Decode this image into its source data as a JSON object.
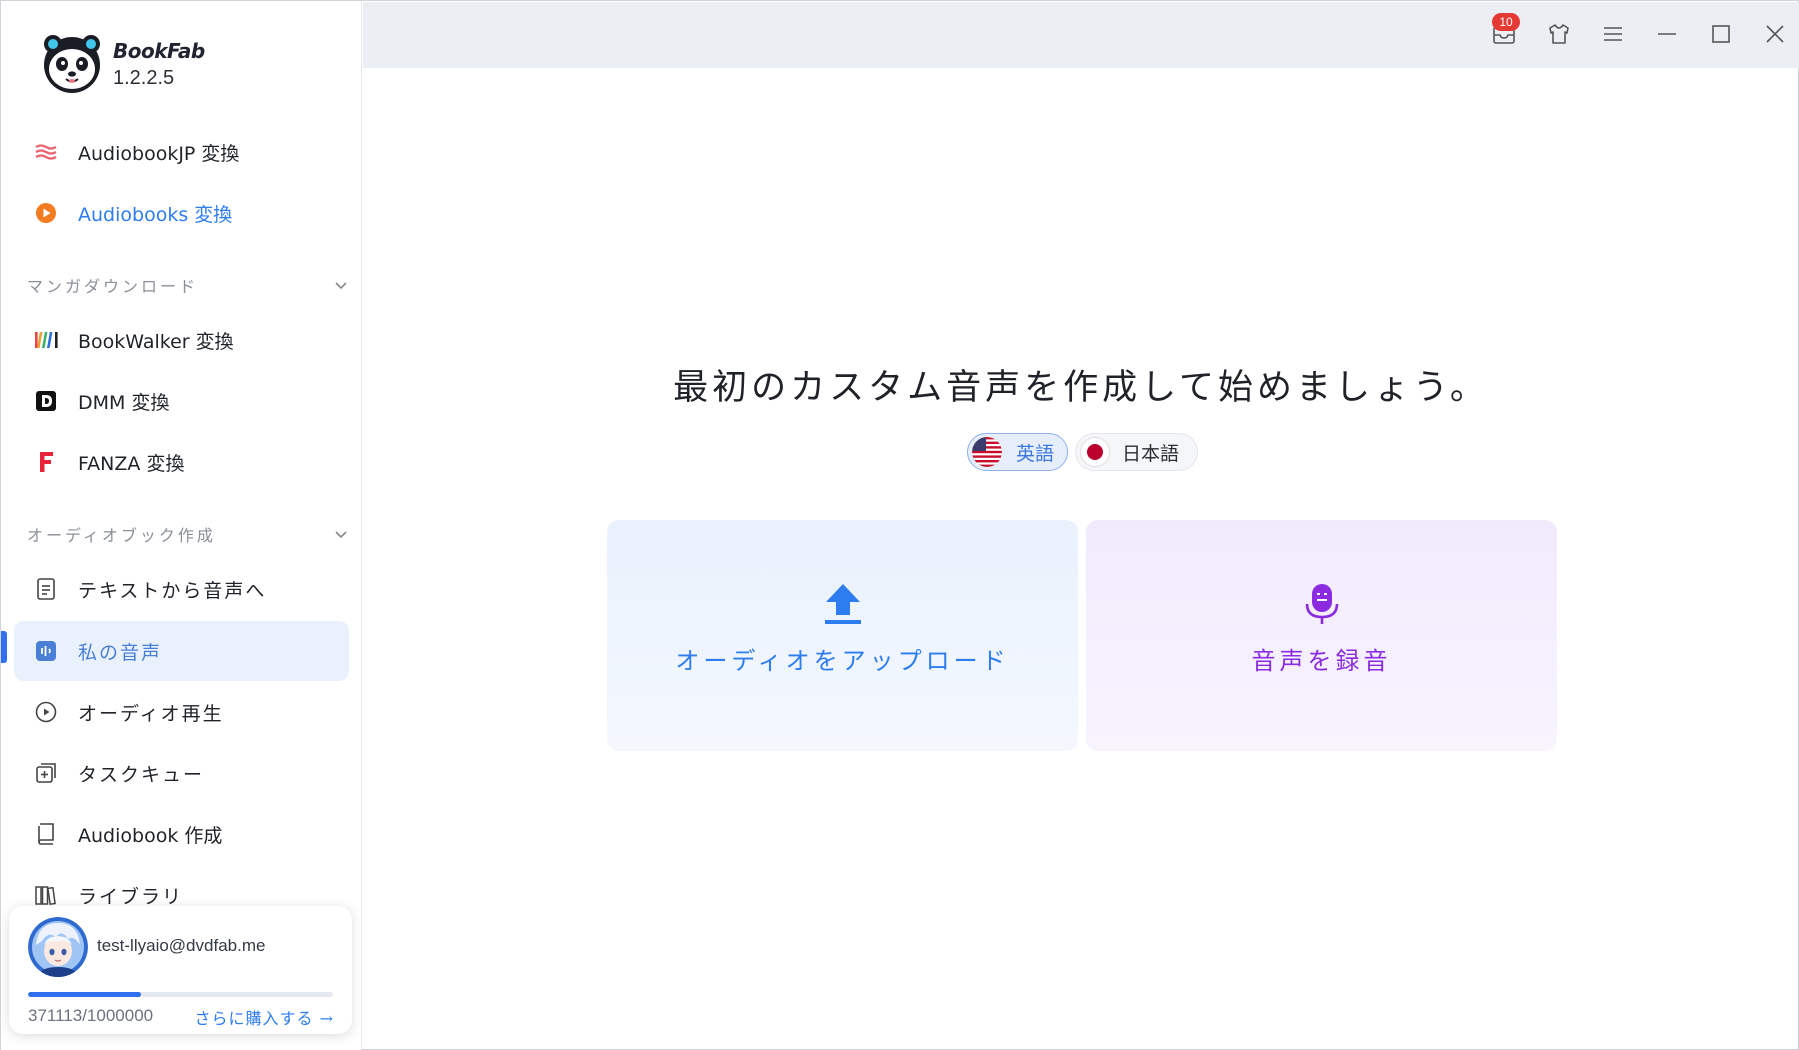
{
  "app": {
    "name": "BookFab",
    "version": "1.2.2.5"
  },
  "topbar": {
    "notification_count": "10",
    "icons": [
      "inbox-icon",
      "shirt-icon",
      "menu-icon",
      "minimize-icon",
      "maximize-icon",
      "close-icon"
    ]
  },
  "sidebar": {
    "items_top": [
      {
        "label": "AudiobookJP 変換",
        "icon": "audiobookjp-icon"
      },
      {
        "label": "Audiobooks 変換",
        "icon": "audiobooks-play-icon"
      }
    ],
    "section_manga": "マンガダウンロード",
    "items_manga": [
      {
        "label": "BookWalker 変換",
        "icon": "bookwalker-icon"
      },
      {
        "label": "DMM 変換",
        "icon": "dmm-icon"
      },
      {
        "label": "FANZA 変換",
        "icon": "fanza-icon"
      }
    ],
    "section_audio": "オーディオブック作成",
    "items_audio": [
      {
        "label": "テキストから音声へ",
        "icon": "document-icon"
      },
      {
        "label": "私の音声",
        "icon": "voice-icon"
      },
      {
        "label": "オーディオ再生",
        "icon": "play-circle-icon"
      },
      {
        "label": "タスクキュー",
        "icon": "task-queue-icon"
      },
      {
        "label": "Audiobook 作成",
        "icon": "book-icon"
      },
      {
        "label": "ライブラリ",
        "icon": "library-icon"
      }
    ]
  },
  "user": {
    "email": "test-llyaio@dvdfab.me",
    "usage_text": "371113/1000000",
    "usage_fraction": 0.371113,
    "buy_label": "さらに購入する →"
  },
  "main": {
    "headline": "最初のカスタム音声を作成して始めましょう。",
    "languages": [
      {
        "label": "英語",
        "selected": true
      },
      {
        "label": "日本語",
        "selected": false
      }
    ],
    "cards": [
      {
        "label": "オーディオをアップロード",
        "icon": "upload-icon"
      },
      {
        "label": "音声を録音",
        "icon": "microphone-icon"
      }
    ]
  },
  "colors": {
    "accent_blue": "#2d7df0",
    "accent_purple": "#8a2be2",
    "badge_red": "#e53935"
  }
}
